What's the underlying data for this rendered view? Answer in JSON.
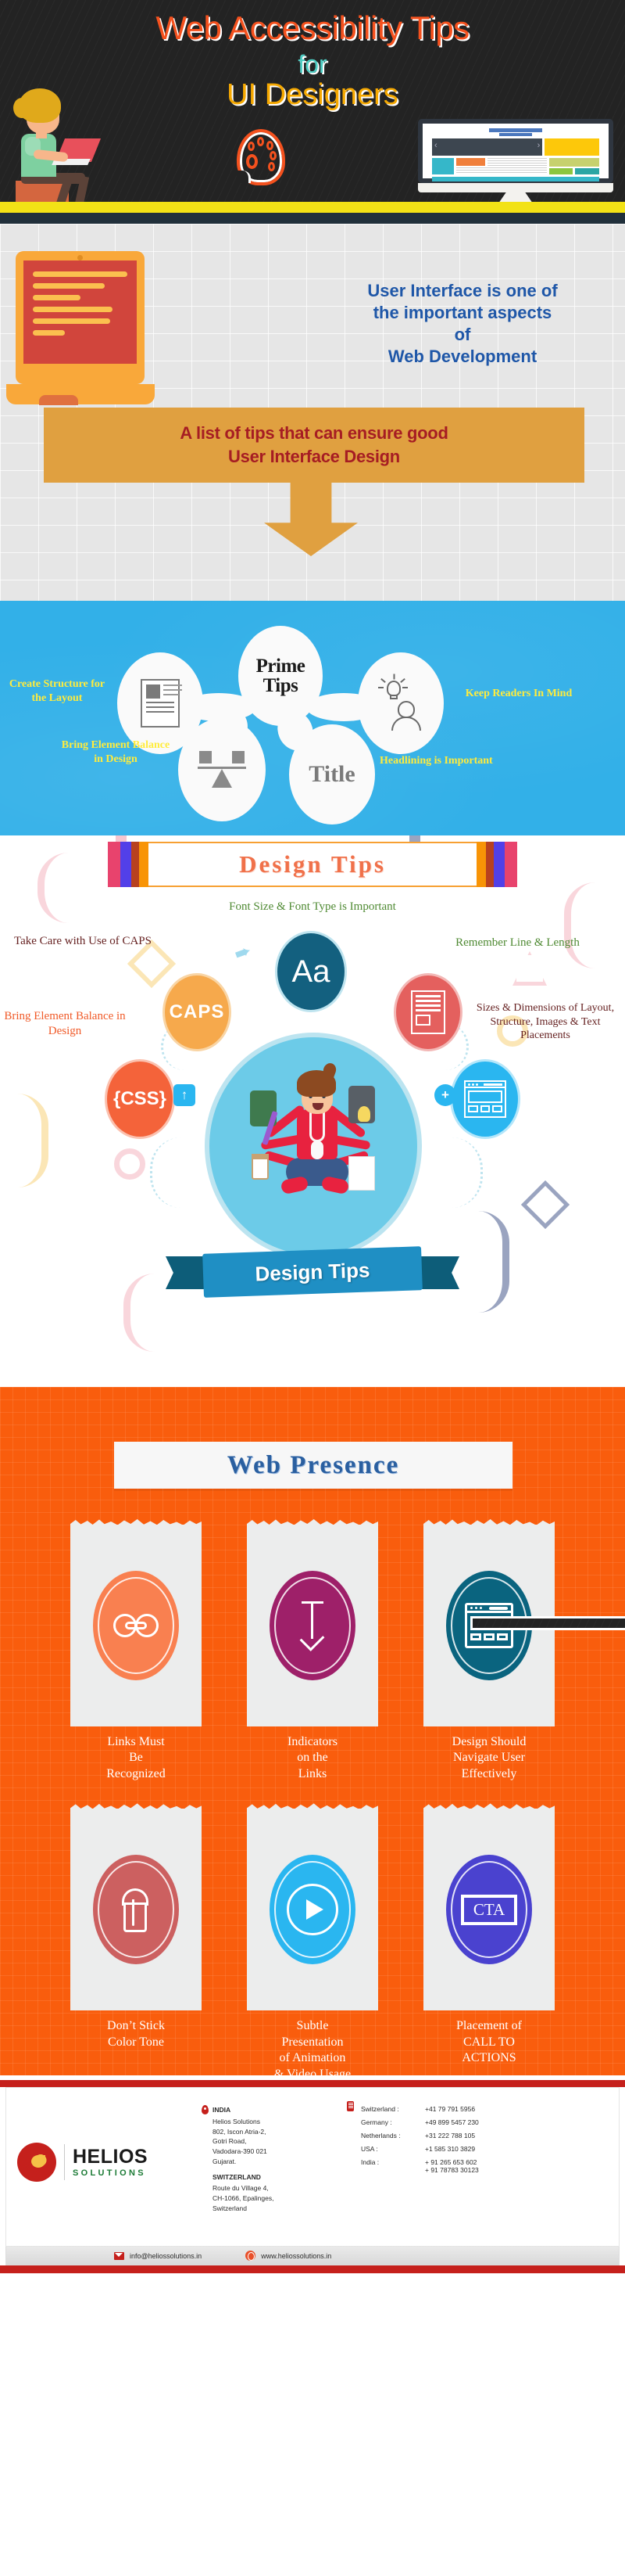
{
  "hero": {
    "title": "Web Accessibility Tips",
    "for": "for",
    "subtitle": "UI Designers",
    "colors": {
      "title": "#f4511e",
      "for": "#4ecdc4",
      "subtitle": "#f5a800",
      "bg": "#232323"
    }
  },
  "intro": {
    "statement": "User Interface is one of the important aspects of Web Development",
    "statement_lines": [
      "User Interface is one of",
      "the important aspects",
      "of",
      "Web Development"
    ],
    "tips_banner_lines": [
      "A list of tips that can ensure good",
      "User Interface Design"
    ],
    "colors": {
      "statement": "#1f57a8",
      "banner_bg": "#e0a040",
      "banner_text": "#a61d23"
    }
  },
  "prime_tips": {
    "center_line1": "Prime",
    "center_line2": "Tips",
    "bg_color": "#32b0e8",
    "label_color": "#ffec3d",
    "items": [
      {
        "label": "Create Structure for the Layout",
        "icon": "document-icon",
        "position": "left"
      },
      {
        "label": "Keep Readers In Mind",
        "icon": "lightbulb-person-icon",
        "position": "right"
      },
      {
        "label": "Bring Element Balance in Design",
        "icon": "balance-scale-icon",
        "position": "bottom-left"
      },
      {
        "label": "Headlining is Important",
        "icon": "title-text-icon",
        "icon_text": "Title",
        "position": "bottom-right"
      }
    ]
  },
  "design_tips": {
    "title": "Design  Tips",
    "headline": "Font Size & Font Type is Important",
    "ribbon_label": "Design Tips",
    "items": [
      {
        "label": "Take Care with Use of CAPS",
        "icon": "caps-circle-icon",
        "icon_text": "CAPS",
        "color": "#f6a94c"
      },
      {
        "label": "Remember Line & Length",
        "icon": "article-lines-icon",
        "color": "#e4605e"
      },
      {
        "label": "Bring Element Balance in Design",
        "icon": "css-braces-icon",
        "icon_text": "{CSS}",
        "color": "#f4633a"
      },
      {
        "label": "Sizes & Dimensions of Layout, Structure, Images & Text Placements",
        "icon": "wireframe-icon",
        "color": "#2ab6f0"
      }
    ],
    "center_icon_text": "Aa",
    "center_icon_color": "#13607f"
  },
  "web_presence": {
    "title": "Web Presence",
    "bg_color": "#f95d0d",
    "title_color": "#2a5fa0",
    "cards": [
      {
        "caption": "Links Must\nBe\nRecognized",
        "icon": "chain-link-icon",
        "color": "#f98050"
      },
      {
        "caption": "Indicators\non the\nLinks",
        "icon": "arrow-down-icon",
        "color": "#9e2069"
      },
      {
        "caption": "Design Should\nNavigate User\nEffectively",
        "icon": "layout-browser-icon",
        "color": "#0a647f"
      },
      {
        "caption": "Don’t Stick\nColor Tone",
        "icon": "paint-bucket-icon",
        "color": "#cc6060"
      },
      {
        "caption": "Subtle\nPresentation\nof Animation\n& Video Usage",
        "icon": "play-button-icon",
        "color": "#2ab6f0"
      },
      {
        "caption": "Placement of\nCALL TO\nACTIONS",
        "icon": "cta-box-icon",
        "icon_text": "CTA",
        "color": "#4a42cf"
      }
    ]
  },
  "footer": {
    "brand": "HELIOS",
    "brand_sub": "SOLUTIONS",
    "offices": [
      {
        "country": "INDIA",
        "address": "Helios Solutions\n802, Iscon Atria-2,\nGotri Road,\nVadodara-390 021\nGujarat."
      },
      {
        "country": "SWITZERLAND",
        "address": "Route du Village 4,\nCH-1066, Epalinges,\nSwitzerland"
      }
    ],
    "phones": [
      {
        "country": "Switzerland :",
        "number": "+41 79 791 5956"
      },
      {
        "country": "Germany :",
        "number": "+49 899 5457 230"
      },
      {
        "country": "Netherlands :",
        "number": "+31 222 788 105"
      },
      {
        "country": "USA :",
        "number": "+1 585 310 3829"
      },
      {
        "country": "India :",
        "number": "+ 91 265 653 602\n+ 91 78783 30123"
      }
    ],
    "email": "info@heliossolutions.in",
    "website": "www.heliossolutions.in"
  }
}
